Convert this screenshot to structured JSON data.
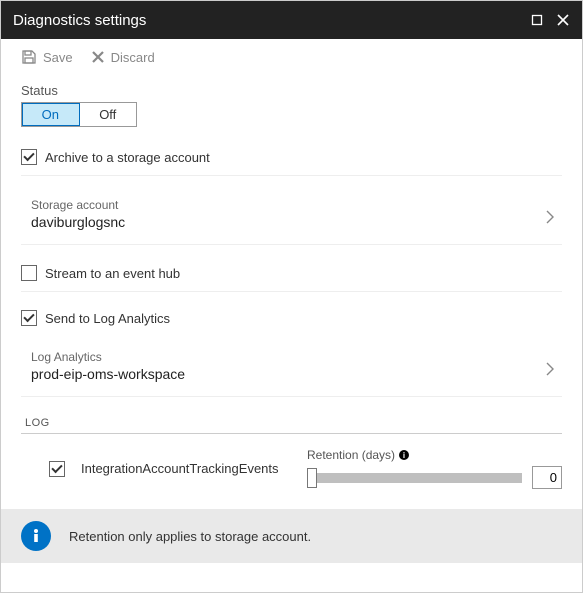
{
  "title": "Diagnostics settings",
  "toolbar": {
    "save": "Save",
    "discard": "Discard"
  },
  "status": {
    "label": "Status",
    "options": [
      "On",
      "Off"
    ],
    "selected": "On"
  },
  "archive": {
    "label": "Archive to a storage account",
    "checked": true,
    "storage": {
      "label": "Storage account",
      "value": "daviburglogsnc"
    }
  },
  "stream": {
    "label": "Stream to an event hub",
    "checked": false
  },
  "sendLA": {
    "label": "Send to Log Analytics",
    "checked": true,
    "la": {
      "label": "Log Analytics",
      "value": "prod-eip-oms-workspace"
    }
  },
  "log": {
    "heading": "LOG",
    "items": [
      {
        "name": "IntegrationAccountTrackingEvents",
        "checked": true,
        "retention_label": "Retention (days)",
        "retention": "0"
      }
    ]
  },
  "info": {
    "text": "Retention only applies to storage account."
  }
}
